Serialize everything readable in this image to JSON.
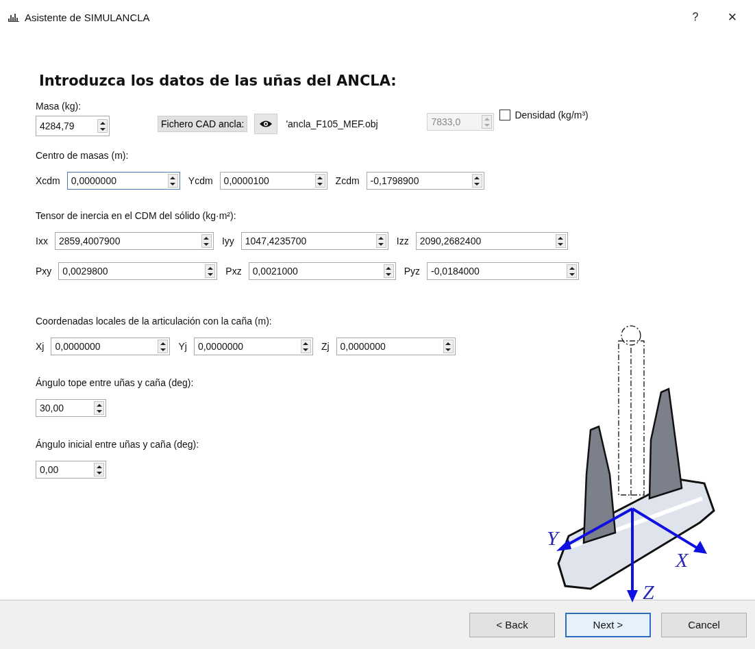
{
  "window": {
    "title": "Asistente de SIMULANCLA",
    "help": "?",
    "close": "×"
  },
  "heading": "Introduzca los datos de las uñas del ANCLA:",
  "mass": {
    "label": "Masa (kg):",
    "value": "4284,79"
  },
  "cad": {
    "button": "Fichero CAD ancla:",
    "file": "'ancla_F105_MEF.obj"
  },
  "density": {
    "value": "7833,0",
    "disabled": true,
    "label": "Densidad (kg/m³)",
    "checked": false
  },
  "groups": [
    {
      "label": "Centro de masas (m):",
      "rows": [
        [
          {
            "label": "Xcdm",
            "value": "0,0000000",
            "focused": true
          },
          {
            "label": "Ycdm",
            "value": "0,0000100",
            "focused": false
          },
          {
            "label": "Zcdm",
            "value": "-0,1798900",
            "focused": false
          }
        ]
      ]
    },
    {
      "label": "Tensor de inercia en el CDM del sólido (kg·m²):",
      "rows": [
        [
          {
            "label": "Ixx",
            "value": "2859,4007900",
            "focused": false
          },
          {
            "label": "Iyy",
            "value": "1047,4235700",
            "focused": false
          },
          {
            "label": "Izz",
            "value": "2090,2682400",
            "focused": false
          }
        ],
        [
          {
            "label": "Pxy",
            "value": "0,0029800",
            "focused": false
          },
          {
            "label": "Pxz",
            "value": "0,0021000",
            "focused": false
          },
          {
            "label": "Pyz",
            "value": "-0,0184000",
            "focused": false
          }
        ]
      ]
    },
    {
      "label": "Coordenadas locales de la articulación con la caña (m):",
      "rows": [
        [
          {
            "label": "Xj",
            "value": "0,0000000",
            "focused": false
          },
          {
            "label": "Yj",
            "value": "0,0000000",
            "focused": false
          },
          {
            "label": "Zj",
            "value": "0,0000000",
            "focused": false
          }
        ]
      ]
    }
  ],
  "angles": [
    {
      "label": "Ángulo tope entre uñas y caña (deg):",
      "value": "30,00"
    },
    {
      "label": "Ángulo inicial entre uñas y caña (deg):",
      "value": "0,00"
    }
  ],
  "drawing": {
    "axes": [
      {
        "kind": "y",
        "label": "Y"
      },
      {
        "kind": "x",
        "label": "X"
      },
      {
        "kind": "z",
        "label": "Z"
      }
    ]
  },
  "buttons": [
    {
      "label": "< Back",
      "default": false
    },
    {
      "label": "Next >",
      "default": true
    },
    {
      "label": "Cancel",
      "default": false
    }
  ]
}
